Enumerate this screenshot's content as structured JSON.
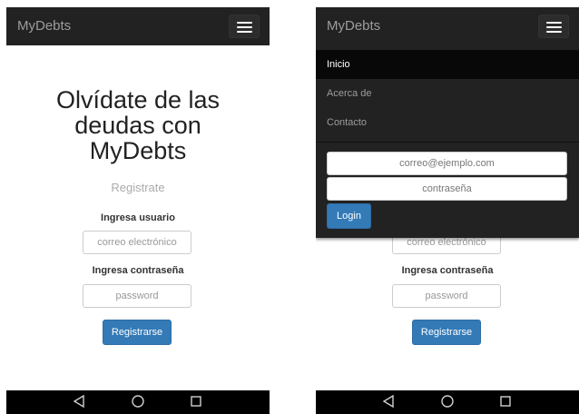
{
  "app": {
    "brand": "MyDebts"
  },
  "hero": {
    "line1": "Olvídate de las",
    "line2": "deudas con",
    "line3": "MyDebts",
    "subtitle": "Registrate"
  },
  "register_form": {
    "user_label": "Ingresa usuario",
    "user_placeholder": "correo electrónico",
    "password_label": "Ingresa contraseña",
    "password_placeholder": "password",
    "submit_label": "Registrarse"
  },
  "menu": {
    "items": [
      {
        "label": "Inicio",
        "active": true
      },
      {
        "label": "Acerca de",
        "active": false
      },
      {
        "label": "Contacto",
        "active": false
      }
    ],
    "login": {
      "email_placeholder": "correo@ejemplo.com",
      "password_placeholder": "contraseña",
      "button_label": "Login"
    }
  },
  "colors": {
    "navbar": "#222222",
    "primary": "#337ab7",
    "text": "#222222",
    "muted": "#aaaaaa"
  },
  "android_nav": {
    "icons": [
      "back-icon",
      "home-icon",
      "recents-icon"
    ]
  }
}
